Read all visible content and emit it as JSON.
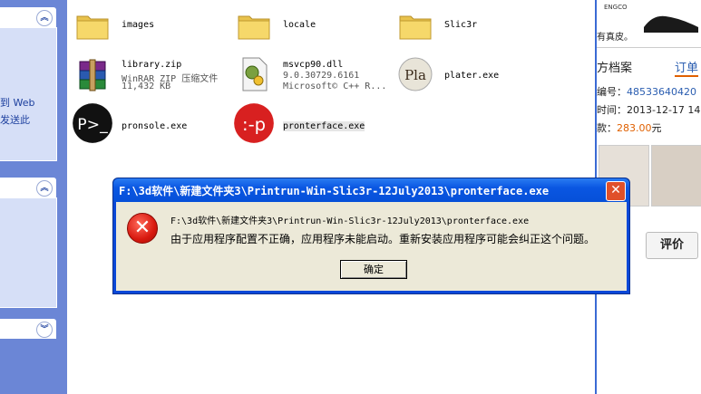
{
  "left_pane": {
    "text_lines": [
      "到 Web",
      "发送此"
    ]
  },
  "files": [
    {
      "name": "images",
      "icon": "folder-icon"
    },
    {
      "name": "locale",
      "icon": "folder-icon"
    },
    {
      "name": "Slic3r",
      "icon": "folder-icon"
    },
    {
      "name": "library.zip",
      "line2": "WinRAR ZIP 压缩文件",
      "line3": "11,432 KB",
      "icon": "winrar-archive-icon"
    },
    {
      "name": "msvcp90.dll",
      "line2": "9.0.30729.6161",
      "line3": "Microsoft© C++ R...",
      "icon": "dll-gear-icon"
    },
    {
      "name": "plater.exe",
      "icon": "plater-app-icon",
      "icon_text": "Pla"
    },
    {
      "name": "pronsole.exe",
      "icon": "pronsole-app-icon",
      "icon_text": "P>_"
    },
    {
      "name": "pronterface.exe",
      "icon": "pronterface-app-icon",
      "icon_text": ":-p"
    }
  ],
  "right_strip": {
    "brand": "ENGCO",
    "ad_text": "有真皮。",
    "tab_left": "方档案",
    "tab_right": "订单",
    "order_no_label": "编号：",
    "order_no_value": "48533640420",
    "time_label": "时间：",
    "time_value": "2013-12-17 14",
    "price_label": "款：",
    "price_value": "283.00",
    "price_unit": "元",
    "review_button": "评价"
  },
  "dialog": {
    "title": "F:\\3d软件\\新建文件夹3\\Printrun-Win-Slic3r-12July2013\\pronterface.exe",
    "path_text": "F:\\3d软件\\新建文件夹3\\Printrun-Win-Slic3r-12July2013\\pronterface.exe",
    "message": "由于应用程序配置不正确，应用程序未能启动。重新安装应用程序可能会纠正这个问题。",
    "ok_label": "确定",
    "close_glyph": "✕"
  },
  "colors": {
    "xp_blue": "#0a48d8",
    "dialog_face": "#ece9d8",
    "price_orange": "#e06000",
    "link_blue": "#2a5db0"
  }
}
